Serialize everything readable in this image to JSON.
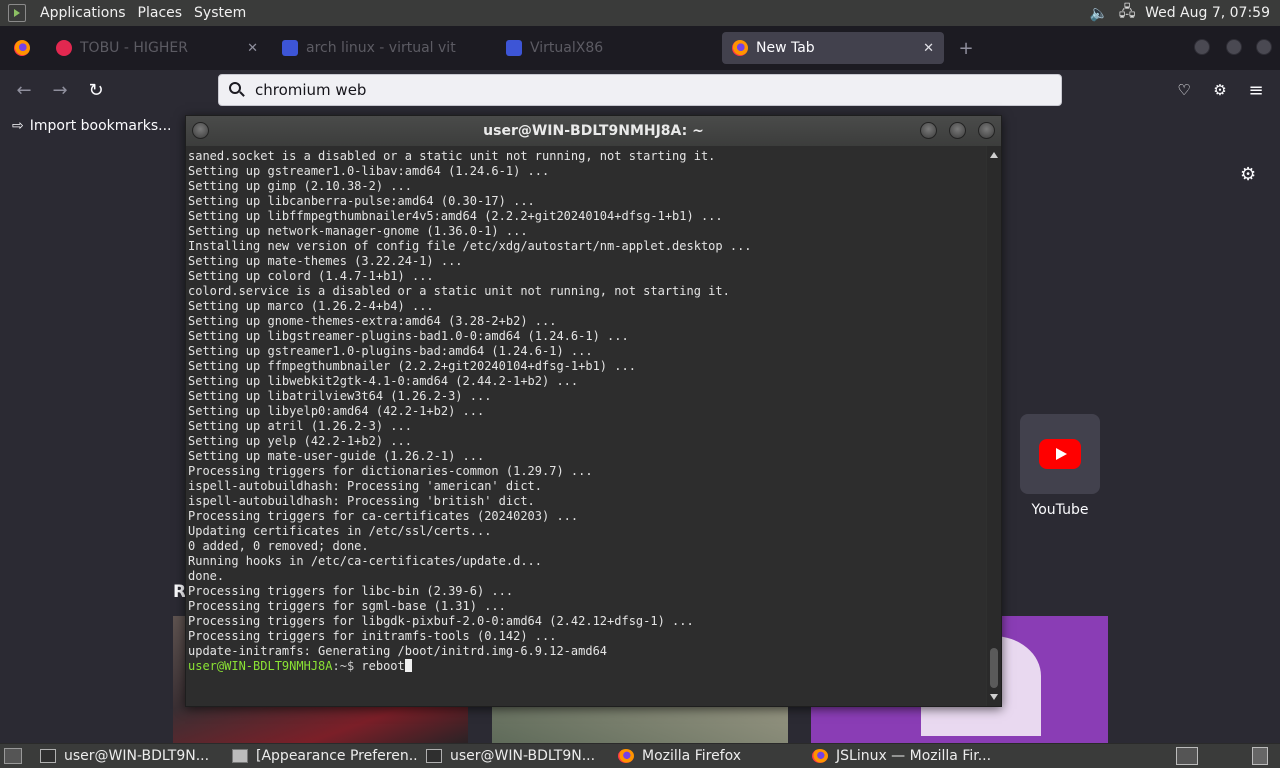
{
  "top_panel": {
    "menus": [
      "Applications",
      "Places",
      "System"
    ],
    "clock": "Wed Aug 7, 07:59",
    "icons": [
      "mate-menu-icon",
      "volume-icon",
      "network-icon"
    ]
  },
  "browser": {
    "tabs": [
      {
        "title": "TOBU - HIGHER",
        "icon": "music-icon"
      },
      {
        "title": "arch linux - virtual vit",
        "icon": "virtualbox-icon"
      },
      {
        "title": "VirtualX86",
        "icon": "virtualbox-icon"
      },
      {
        "title": "New Tab",
        "icon": "firefox-icon"
      }
    ],
    "url_value": "chromium web",
    "bookmarks_toolbar": {
      "import_label": "Import bookmarks..."
    },
    "new_tab": {
      "shortcut": {
        "label": "YouTube"
      },
      "recommended_heading": "R"
    }
  },
  "terminal": {
    "title": "user@WIN-BDLT9NMHJ8A: ~",
    "lines": [
      "saned.socket is a disabled or a static unit not running, not starting it.",
      "Setting up gstreamer1.0-libav:amd64 (1.24.6-1) ...",
      "Setting up gimp (2.10.38-2) ...",
      "Setting up libcanberra-pulse:amd64 (0.30-17) ...",
      "Setting up libffmpegthumbnailer4v5:amd64 (2.2.2+git20240104+dfsg-1+b1) ...",
      "Setting up network-manager-gnome (1.36.0-1) ...",
      "Installing new version of config file /etc/xdg/autostart/nm-applet.desktop ...",
      "Setting up mate-themes (3.22.24-1) ...",
      "Setting up colord (1.4.7-1+b1) ...",
      "colord.service is a disabled or a static unit not running, not starting it.",
      "Setting up marco (1.26.2-4+b4) ...",
      "Setting up gnome-themes-extra:amd64 (3.28-2+b2) ...",
      "Setting up libgstreamer-plugins-bad1.0-0:amd64 (1.24.6-1) ...",
      "Setting up gstreamer1.0-plugins-bad:amd64 (1.24.6-1) ...",
      "Setting up ffmpegthumbnailer (2.2.2+git20240104+dfsg-1+b1) ...",
      "Setting up libwebkit2gtk-4.1-0:amd64 (2.44.2-1+b2) ...",
      "Setting up libatrilview3t64 (1.26.2-3) ...",
      "Setting up libyelp0:amd64 (42.2-1+b2) ...",
      "Setting up atril (1.26.2-3) ...",
      "Setting up yelp (42.2-1+b2) ...",
      "Setting up mate-user-guide (1.26.2-1) ...",
      "Processing triggers for dictionaries-common (1.29.7) ...",
      "ispell-autobuildhash: Processing 'american' dict.",
      "ispell-autobuildhash: Processing 'british' dict.",
      "Processing triggers for ca-certificates (20240203) ...",
      "Updating certificates in /etc/ssl/certs...",
      "0 added, 0 removed; done.",
      "Running hooks in /etc/ca-certificates/update.d...",
      "done.",
      "Processing triggers for libc-bin (2.39-6) ...",
      "Processing triggers for sgml-base (1.31) ...",
      "Processing triggers for libgdk-pixbuf-2.0-0:amd64 (2.42.12+dfsg-1) ...",
      "Processing triggers for initramfs-tools (0.142) ...",
      "update-initramfs: Generating /boot/initrd.img-6.9.12-amd64"
    ],
    "prompt": {
      "user_host": "user@WIN-BDLT9NMHJ8A",
      "path": ":~$",
      "command": " reboot"
    }
  },
  "taskbar": {
    "tasks": [
      {
        "label": "user@WIN-BDLT9N...",
        "icon": "terminal-icon"
      },
      {
        "label": "[Appearance Preferen...",
        "icon": "preferences-icon"
      },
      {
        "label": "user@WIN-BDLT9N...",
        "icon": "terminal-icon"
      },
      {
        "label": "Mozilla Firefox",
        "icon": "firefox-icon"
      },
      {
        "label": "JSLinux — Mozilla Fir...",
        "icon": "firefox-icon"
      }
    ]
  }
}
